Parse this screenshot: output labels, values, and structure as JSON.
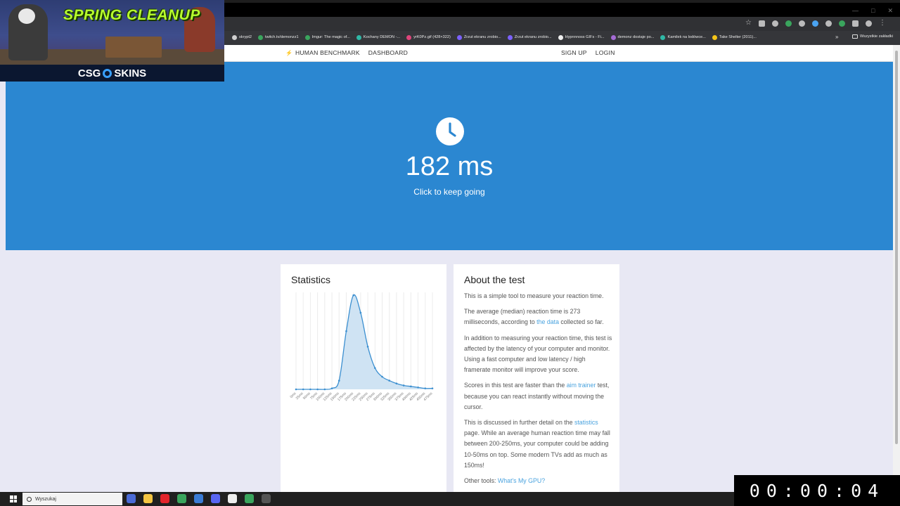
{
  "browser": {
    "bookmarks": [
      {
        "label": "skrypt2",
        "color": "#cfcfcf"
      },
      {
        "label": "twitch.tv/demonzz1",
        "color": "#3aa55d"
      },
      {
        "label": "Imgur: The magic of...",
        "color": "#3aa55d"
      },
      {
        "label": "Kochany DEMON -...",
        "color": "#2fb8a6"
      },
      {
        "label": "yrK0Pz.gif (428×322)",
        "color": "#e0457b"
      },
      {
        "label": "Zrzut ekranu zrobio...",
        "color": "#7b61ff"
      },
      {
        "label": "Zrzut ekranu zrobio...",
        "color": "#7b61ff"
      },
      {
        "label": "Hypnnnoss GIFs - Fi...",
        "color": "#eeeeee"
      },
      {
        "label": "demonz dostaje po...",
        "color": "#a56bd6"
      },
      {
        "label": "Kamilek na lodówce...",
        "color": "#2fb8a6"
      },
      {
        "label": "Take Shelter (2011)...",
        "color": "#f5c518"
      }
    ],
    "bookmarks_more": "»",
    "other_bookmarks": "Wszystkie zakładki"
  },
  "nav": {
    "brand": "HUMAN BENCHMARK",
    "dashboard": "DASHBOARD",
    "signup": "SIGN UP",
    "login": "LOGIN"
  },
  "hero": {
    "result": "182 ms",
    "hint": "Click to keep going",
    "bg_color": "#2b87d1"
  },
  "stats": {
    "title": "Statistics"
  },
  "chart_data": {
    "type": "area",
    "title": "",
    "x_labels": [
      "0ms",
      "25ms",
      "50ms",
      "75ms",
      "100ms",
      "125ms",
      "150ms",
      "175ms",
      "200ms",
      "225ms",
      "250ms",
      "275ms",
      "300ms",
      "325ms",
      "350ms",
      "375ms",
      "400ms",
      "425ms",
      "450ms",
      "475ms"
    ],
    "x": [
      0,
      25,
      50,
      75,
      100,
      125,
      150,
      175,
      200,
      225,
      250,
      275,
      300,
      325,
      350,
      375,
      400,
      425,
      450,
      475
    ],
    "y": [
      0,
      0,
      0,
      0,
      0,
      1,
      9,
      60,
      97,
      79,
      44,
      22,
      13,
      9,
      6,
      4,
      3,
      2,
      1,
      1
    ],
    "ylim": [
      0,
      100
    ],
    "series_color": "#3b8fd0",
    "fill_color": "#cfe3f3"
  },
  "about": {
    "title": "About the test",
    "p1": "This is a simple tool to measure your reaction time.",
    "p2_a": "The average (median) reaction time is 273 milliseconds, according to ",
    "p2_link": "the data",
    "p2_b": " collected so far.",
    "p3": "In addition to measuring your reaction time, this test is affected by the latency of your computer and monitor. Using a fast computer and low latency / high framerate monitor will improve your score.",
    "p4_a": "Scores in this test are faster than the ",
    "p4_link": "aim trainer",
    "p4_b": " test, because you can react instantly without moving the cursor.",
    "p5_a": "This is discussed in further detail on the ",
    "p5_link": "statistics",
    "p5_b": " page. While an average human reaction time may fall between 200-250ms, your computer could be adding 10-50ms on top. Some modern TVs add as much as 150ms!",
    "p6_a": "Other tools: ",
    "p6_link": "What's My GPU?"
  },
  "taskbar": {
    "search_placeholder": "Wyszukaj",
    "apps": [
      {
        "name": "copilot",
        "color": "#4b6bd6"
      },
      {
        "name": "file-explorer",
        "color": "#f4c542"
      },
      {
        "name": "opera",
        "color": "#e3242b"
      },
      {
        "name": "chrome",
        "color": "#3aa55d"
      },
      {
        "name": "store",
        "color": "#3a7bd5"
      },
      {
        "name": "discord",
        "color": "#5865f2"
      },
      {
        "name": "capcut",
        "color": "#eeeeee"
      },
      {
        "name": "chrome-2",
        "color": "#3aa55d"
      },
      {
        "name": "obs",
        "color": "#555555"
      }
    ]
  },
  "overlay": {
    "title": "SPRING CLEANUP",
    "brand_left": "CSG",
    "brand_right": "SKINS"
  },
  "timer": {
    "value": "00:00:04"
  }
}
